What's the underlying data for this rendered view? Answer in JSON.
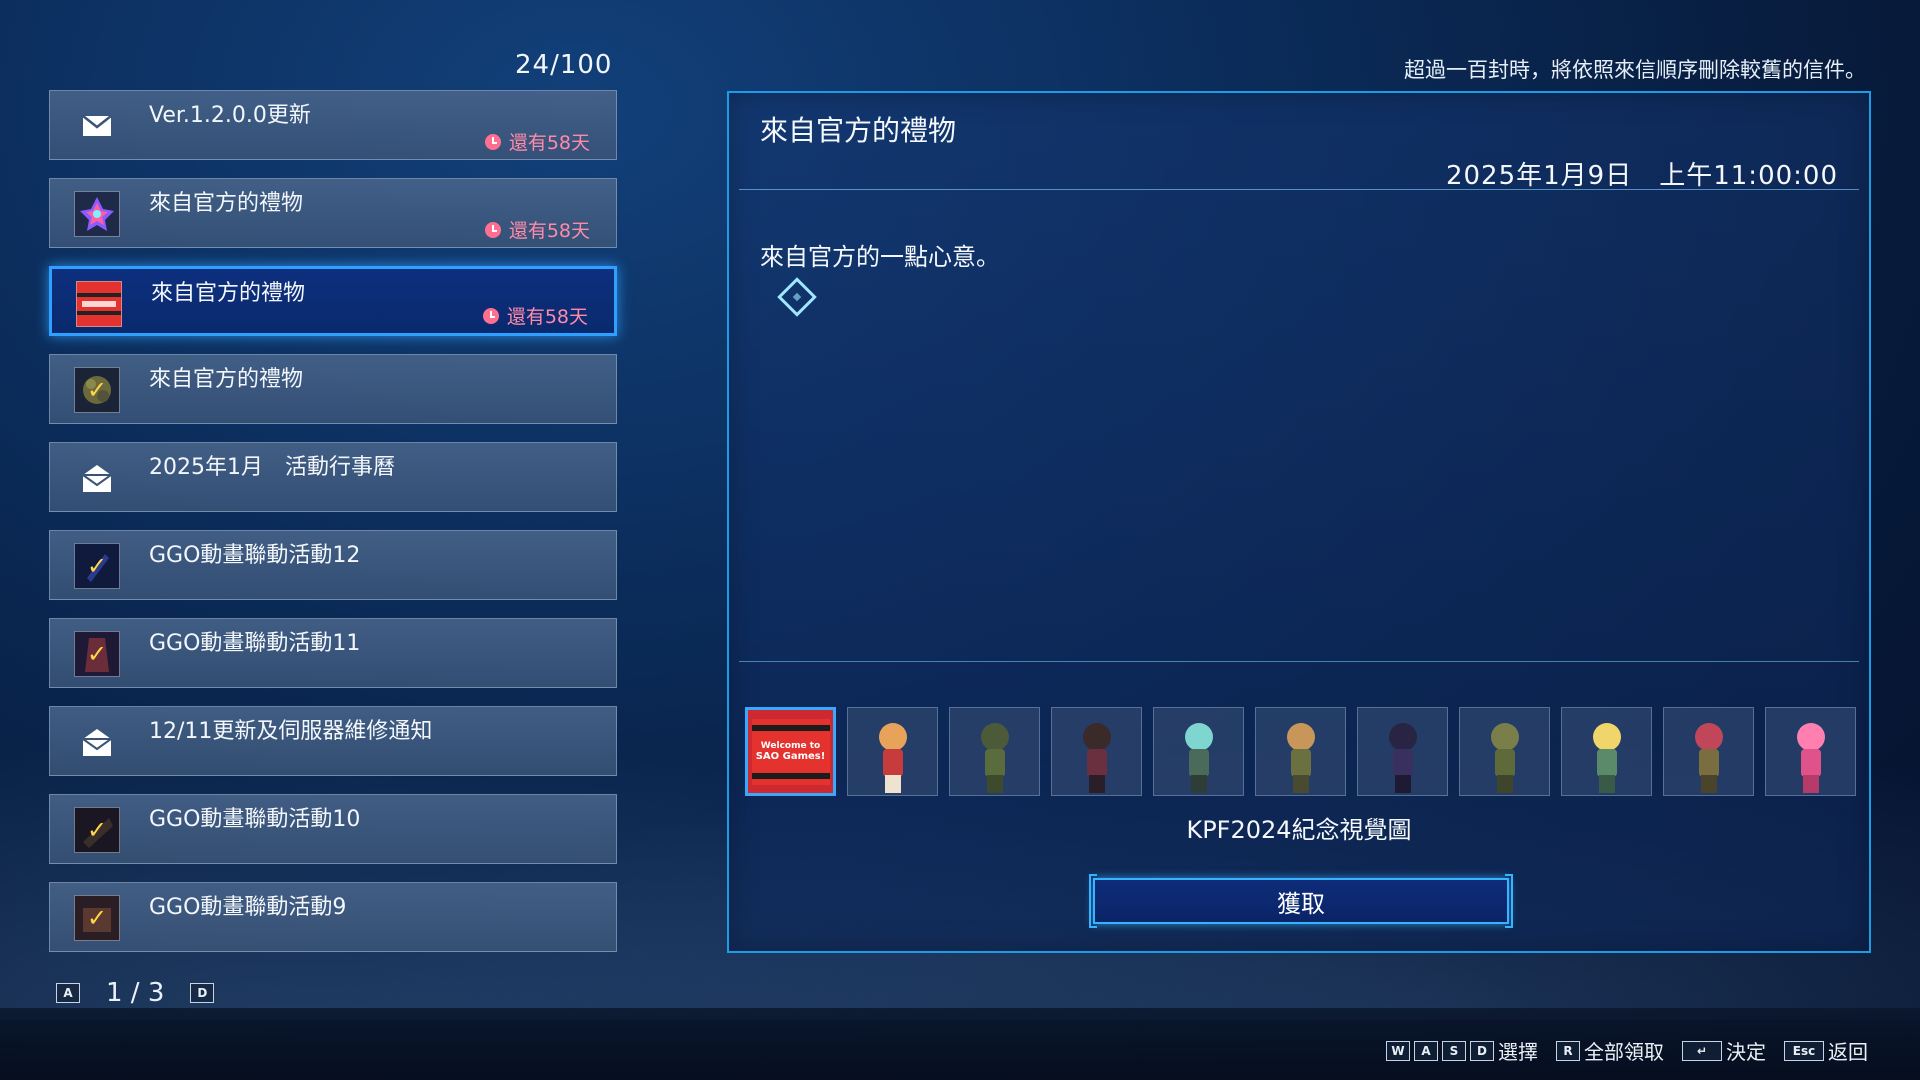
{
  "counter": "24/100",
  "notice": "超過一百封時，將依照來信順序刪除較舊的信件。",
  "mails": [
    {
      "title": "Ver.1.2.0.0更新",
      "expire": "還有58天",
      "icon": "envelope-icon"
    },
    {
      "title": "來自官方的禮物",
      "expire": "還有58天",
      "icon": "gift-crystal-icon"
    },
    {
      "title": "來自官方的禮物",
      "expire": "還有58天",
      "icon": "welcome-banner-thumbnail"
    },
    {
      "title": "來自官方的禮物",
      "expire": "",
      "icon": "claimed-item-icon"
    },
    {
      "title": "2025年1月　活動行事曆",
      "expire": "",
      "icon": "open-envelope-icon"
    },
    {
      "title": "GGO動畫聯動活動12",
      "expire": "",
      "icon": "claimed-item-icon"
    },
    {
      "title": "GGO動畫聯動活動11",
      "expire": "",
      "icon": "claimed-item-icon"
    },
    {
      "title": "12/11更新及伺服器維修通知",
      "expire": "",
      "icon": "open-envelope-icon"
    },
    {
      "title": "GGO動畫聯動活動10",
      "expire": "",
      "icon": "claimed-item-icon"
    },
    {
      "title": "GGO動畫聯動活動9",
      "expire": "",
      "icon": "claimed-item-icon"
    }
  ],
  "pager": {
    "prev_key": "A",
    "page": "1 / 3",
    "next_key": "D"
  },
  "detail": {
    "title": "來自官方的禮物",
    "date": "2025年1月9日　上午11:00:00",
    "body": "來自官方的一點心意。",
    "reward_name": "KPF2024紀念視覺圖",
    "claim_label": "獲取"
  },
  "rewards": {
    "banner_text_1": "Welcome to",
    "banner_text_2": "SAO Games!",
    "items": [
      "welcome-banner",
      "chibi-1",
      "chibi-2",
      "chibi-3",
      "chibi-4",
      "chibi-5",
      "chibi-6",
      "chibi-7",
      "chibi-8",
      "chibi-9",
      "chibi-10"
    ]
  },
  "footer": {
    "select_keys": [
      "W",
      "A",
      "S",
      "D"
    ],
    "select_label": "選擇",
    "claim_all_key": "R",
    "claim_all_label": "全部領取",
    "confirm_key": "↵",
    "confirm_label": "決定",
    "back_key": "Esc",
    "back_label": "返回"
  },
  "colors": {
    "accent": "#2fa0ff",
    "expire": "#ff8aa8",
    "check": "#ffd54a"
  }
}
